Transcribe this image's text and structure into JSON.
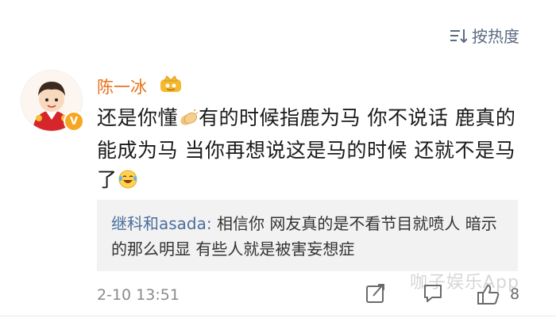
{
  "sort": {
    "label": "按热度",
    "icon": "sort-icon"
  },
  "comment": {
    "user_name": "陈一冰",
    "avatar_icon": "avatar-cartoon-boy",
    "badge_icon": "verified-v-icon",
    "vip_icon": "vip-crown-icon",
    "text_part1": "还是你懂",
    "emoji_1": "clapping-hands-emoji",
    "text_part2": "有的时候指鹿为马 你不说话 鹿真的能成为马 当你再想说这是马的时候 还就不是马了",
    "emoji_2": "laughing-tears-emoji",
    "timestamp": "2-10 13:51",
    "like_count": "8"
  },
  "reply": {
    "user": "继科和asada:",
    "text": " 相信你 网友真的是不看节目就喷人 暗示的那么明显 有些人就是被害妄想症"
  },
  "actions": {
    "repost_icon": "repost-icon",
    "comment_icon": "comment-icon",
    "like_icon": "thumbs-up-icon"
  },
  "watermark": "咖子娱乐App",
  "colors": {
    "name": "#e8721c",
    "reply_user": "#4a6e9c",
    "meta": "#8a8a8a"
  }
}
